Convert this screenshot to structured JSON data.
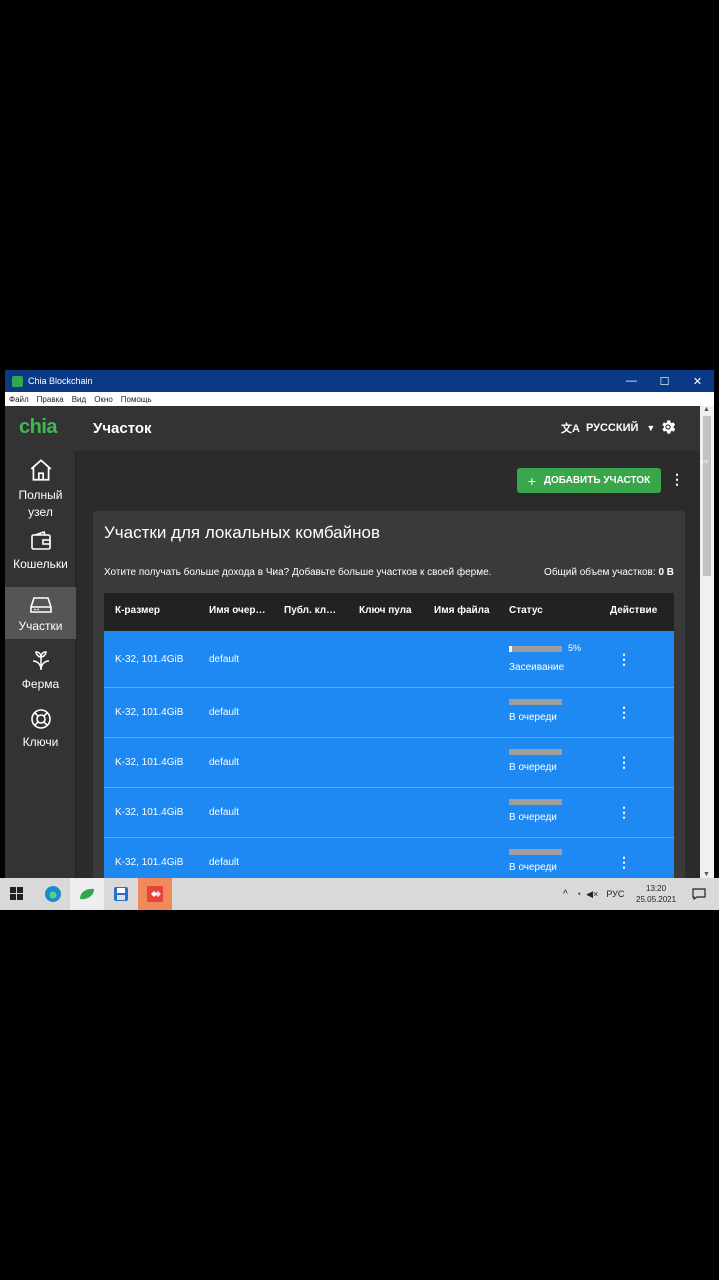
{
  "window": {
    "title": "Chia Blockchain",
    "controls": [
      "—",
      "☐",
      "✕"
    ]
  },
  "menu": [
    "Файл",
    "Правка",
    "Вид",
    "Окно",
    "Помощь"
  ],
  "app": {
    "logo": "chia",
    "page_title": "Участок",
    "language": "РУССКИЙ"
  },
  "sidebar": [
    {
      "label": "Полный узел",
      "icon": "home-icon"
    },
    {
      "label": "Кошельки",
      "icon": "wallet-icon"
    },
    {
      "label": "Участки",
      "icon": "hard-drive-icon",
      "active": true
    },
    {
      "label": "Ферма",
      "icon": "sprout-icon"
    },
    {
      "label": "Ключи",
      "icon": "lifebuoy-icon"
    }
  ],
  "add_button": "ДОБАВИТЬ УЧАСТОК",
  "card": {
    "title": "Участки для локальных комбайнов",
    "description": "Хотите получать больше дохода в Чиа? Добавьте больше участков к своей ферме.",
    "total_label": "Общий объем участков:",
    "total_value": "0 B"
  },
  "table": {
    "headers": [
      "К-размер",
      "Имя очер…",
      "Публ. кл…",
      "Ключ пула",
      "Имя файла",
      "Статус",
      "Действие"
    ],
    "rows": [
      {
        "ksize": "K-32, 101.4GiB",
        "queue": "default",
        "status": "Засеивание",
        "progress": 0.05,
        "progress_label": "5%"
      },
      {
        "ksize": "K-32, 101.4GiB",
        "queue": "default",
        "status": "В очереди",
        "progress": 0
      },
      {
        "ksize": "K-32, 101.4GiB",
        "queue": "default",
        "status": "В очереди",
        "progress": 0
      },
      {
        "ksize": "K-32, 101.4GiB",
        "queue": "default",
        "status": "В очереди",
        "progress": 0
      },
      {
        "ksize": "K-32, 101.4GiB",
        "queue": "default",
        "status": "В очереди",
        "progress": 0
      }
    ]
  },
  "taskbar": {
    "lang": "РУС",
    "time": "13:20",
    "date": "25.05.2021"
  }
}
